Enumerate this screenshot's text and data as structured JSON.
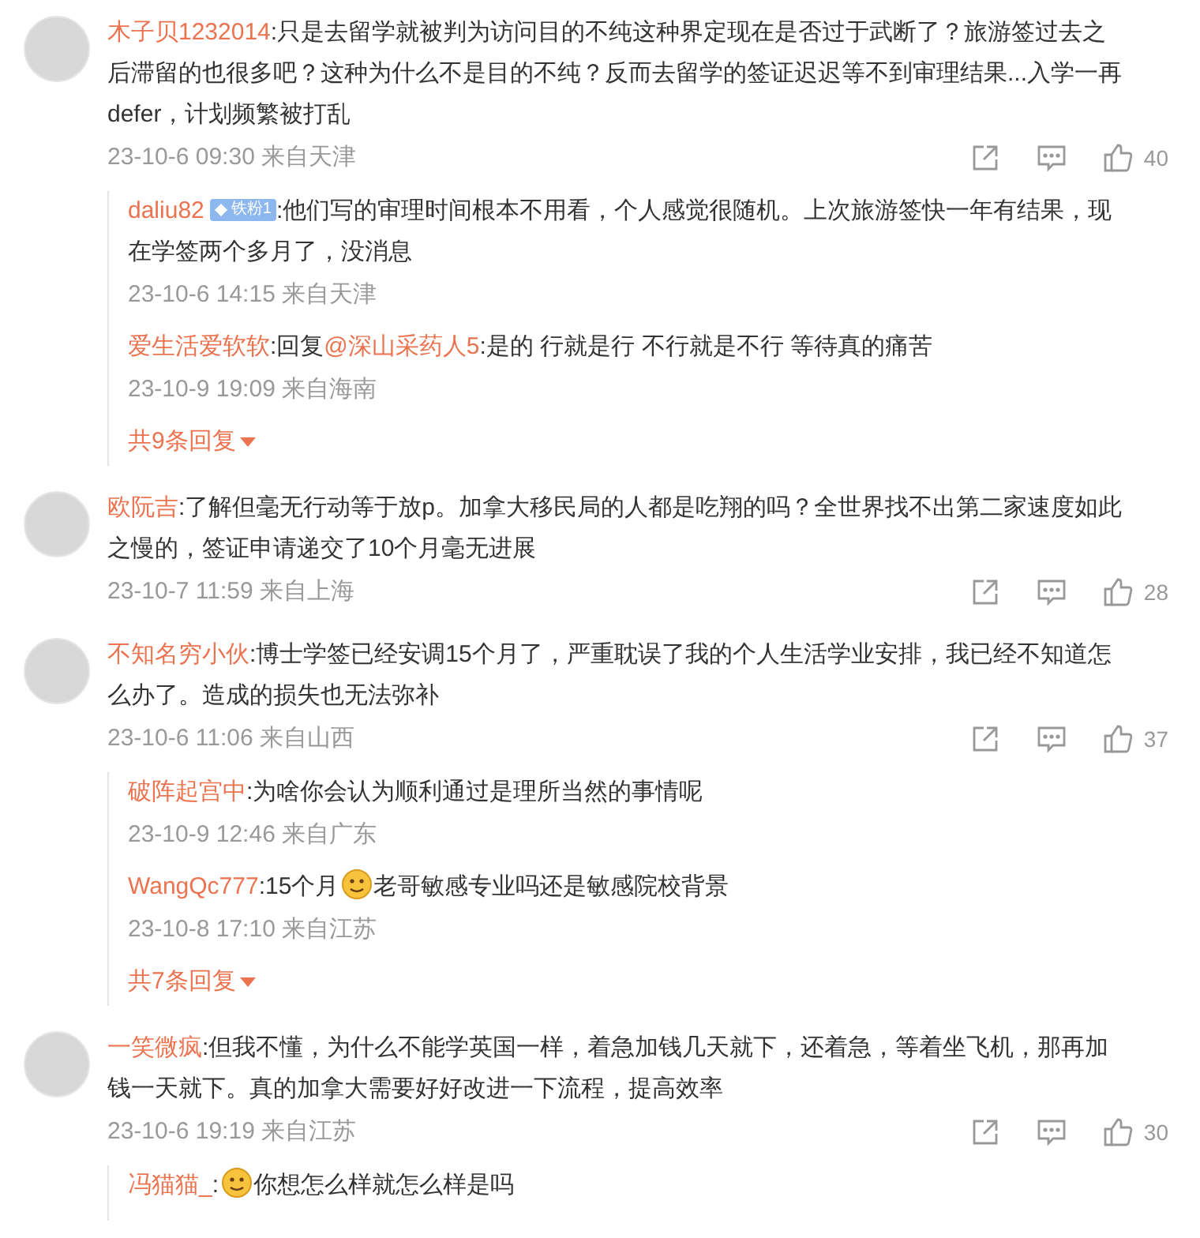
{
  "comments": [
    {
      "author": "木子贝1232014",
      "parts": [
        {
          "kind": "text",
          "text": ":只是去留学就被判为访问目的不纯这种界定现在是否过于武断了？旅游签过去之后滞留的也很多吧？这种为什么不是目的不纯？反而去留学的签证迟迟等不到审理结果...入学一再defer，计划频繁被打乱"
        }
      ],
      "time": "23-10-6 09:30 来自天津",
      "likes": "40",
      "replies": [
        {
          "author": "daliu82",
          "badge": "铁粉1",
          "parts": [
            {
              "kind": "text",
              "text": ":他们写的审理时间根本不用看，个人感觉很随机。上次旅游签快一年有结果，现在学签两个多月了，没消息"
            }
          ],
          "time": "23-10-6 14:15 来自天津"
        },
        {
          "author": "爱生活爱软软",
          "parts": [
            {
              "kind": "text",
              "text": ":回复"
            },
            {
              "kind": "mention",
              "text": "@深山采药人5"
            },
            {
              "kind": "text",
              "text": ":是的 行就是行 不行就是不行 等待真的痛苦"
            }
          ],
          "time": "23-10-9 19:09 来自海南"
        }
      ],
      "more_replies": "共9条回复"
    },
    {
      "author": "欧阮吉",
      "parts": [
        {
          "kind": "text",
          "text": ":了解但毫无行动等于放p。加拿大移民局的人都是吃翔的吗？全世界找不出第二家速度如此之慢的，签证申请递交了10个月毫无进展"
        }
      ],
      "time": "23-10-7 11:59 来自上海",
      "likes": "28"
    },
    {
      "author": "不知名穷小伙",
      "parts": [
        {
          "kind": "text",
          "text": ":博士学签已经安调15个月了，严重耽误了我的个人生活学业安排，我已经不知道怎么办了。造成的损失也无法弥补"
        }
      ],
      "time": "23-10-6 11:06 来自山西",
      "likes": "37",
      "replies": [
        {
          "author": "破阵起宫中",
          "parts": [
            {
              "kind": "text",
              "text": ":为啥你会认为顺利通过是理所当然的事情呢"
            }
          ],
          "time": "23-10-9 12:46 来自广东"
        },
        {
          "author": "WangQc777",
          "parts": [
            {
              "kind": "text",
              "text": ":15个月"
            },
            {
              "kind": "emoji"
            },
            {
              "kind": "text",
              "text": "老哥敏感专业吗还是敏感院校背景"
            }
          ],
          "time": "23-10-8 17:10 来自江苏"
        }
      ],
      "more_replies": "共7条回复"
    },
    {
      "author": "一笑微疯",
      "parts": [
        {
          "kind": "text",
          "text": ":但我不懂，为什么不能学英国一样，着急加钱几天就下，还着急，等着坐飞机，那再加钱一天就下。真的加拿大需要好好改进一下流程，提高效率"
        }
      ],
      "time": "23-10-6 19:19 来自江苏",
      "likes": "30",
      "replies": [
        {
          "author": "冯猫猫_",
          "parts": [
            {
              "kind": "text",
              "text": ":"
            },
            {
              "kind": "emoji"
            },
            {
              "kind": "text",
              "text": "你想怎么样就怎么样是吗"
            }
          ]
        }
      ]
    }
  ]
}
